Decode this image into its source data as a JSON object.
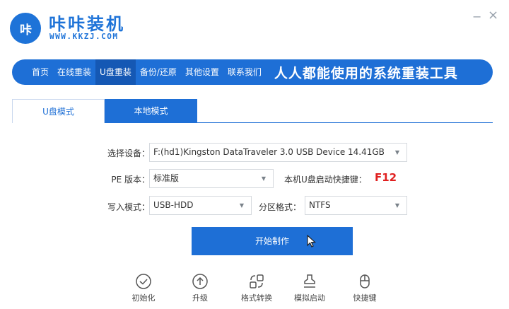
{
  "header": {
    "logo_text": "咔",
    "brand_name": "咔咔装机",
    "brand_url": "WWW.KKZJ.COM",
    "minimize": "−",
    "close": "×"
  },
  "nav": {
    "items": [
      {
        "label": "首页"
      },
      {
        "label": "在线重装"
      },
      {
        "label": "U盘重装"
      },
      {
        "label": "备份/还原"
      },
      {
        "label": "其他设置"
      },
      {
        "label": "联系我们"
      }
    ],
    "active_index": 2,
    "slogan": "人人都能使用的系统重装工具"
  },
  "tabs": [
    {
      "label": "U盘模式",
      "active": true
    },
    {
      "label": "本地模式",
      "active": false
    }
  ],
  "form": {
    "device_label": "选择设备：",
    "device_value": "F:(hd1)Kingston DataTraveler 3.0 USB Device 14.41GB",
    "pe_label": "PE 版本：",
    "pe_value": "标准版",
    "hotkey_label": "本机U盘启动快捷键：",
    "hotkey_value": "F12",
    "write_label": "写入模式：",
    "write_value": "USB-HDD",
    "partition_label": "分区格式：",
    "partition_value": "NTFS"
  },
  "start_button": "开始制作",
  "tools": [
    {
      "label": "初始化",
      "icon": "check-circle-icon"
    },
    {
      "label": "升级",
      "icon": "arrow-up-circle-icon"
    },
    {
      "label": "格式转换",
      "icon": "convert-icon"
    },
    {
      "label": "模拟启动",
      "icon": "stamp-icon"
    },
    {
      "label": "快捷键",
      "icon": "mouse-icon"
    }
  ],
  "colors": {
    "brand_blue": "#1e6fd6",
    "nav_active": "#1558b4",
    "hotkey_red": "#e02020"
  }
}
